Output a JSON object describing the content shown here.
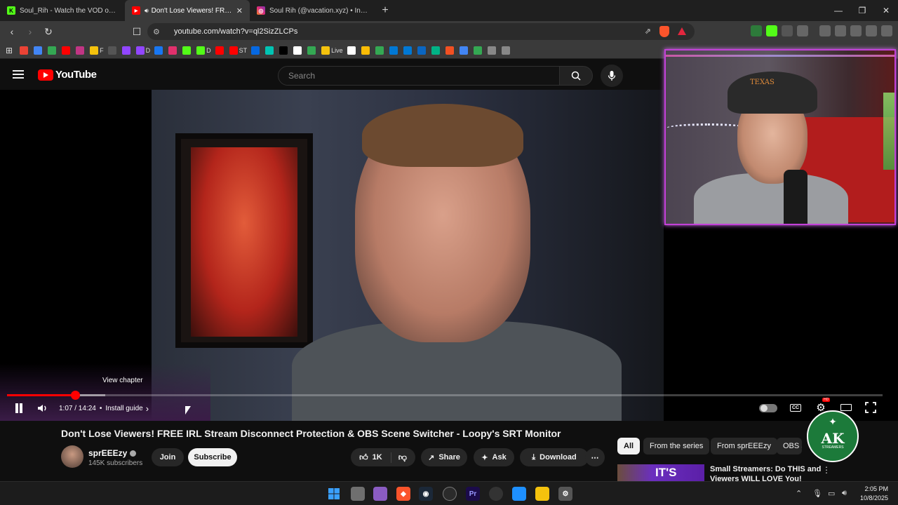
{
  "tabs": [
    {
      "title": "Soul_Rih - Watch the VOD on Kick",
      "active": false,
      "favicon_color": "#53fc18",
      "favicon_glyph": "K"
    },
    {
      "title": "Don't Lose Viewers! FREE IRL",
      "active": true,
      "favicon_color": "#ff0000",
      "favicon_glyph": "▶"
    },
    {
      "title": "Soul Rih (@vacation.xyz) • Instagram",
      "active": false,
      "favicon_color": "#d6249f",
      "favicon_glyph": "◎"
    }
  ],
  "new_tab_label": "+",
  "url": "youtube.com/watch?v=ql2SizZLCPs",
  "bookmarks": [
    {
      "label": "",
      "color": "#ea4335"
    },
    {
      "label": "",
      "color": "#4285f4"
    },
    {
      "label": "",
      "color": "#34a853"
    },
    {
      "label": "",
      "color": "#ff0000"
    },
    {
      "label": "",
      "color": "#c13584"
    },
    {
      "label": "F",
      "color": "#f4c20d"
    },
    {
      "label": "",
      "color": "#555555"
    },
    {
      "label": "",
      "color": "#9146ff"
    },
    {
      "label": "D",
      "color": "#9146ff"
    },
    {
      "label": "",
      "color": "#1877f2"
    },
    {
      "label": "",
      "color": "#e1306c"
    },
    {
      "label": "",
      "color": "#53fc18"
    },
    {
      "label": "D",
      "color": "#53fc18"
    },
    {
      "label": "",
      "color": "#ff0000"
    },
    {
      "label": "ST",
      "color": "#ff0000"
    },
    {
      "label": "",
      "color": "#0668e1"
    },
    {
      "label": "",
      "color": "#00c4b3"
    },
    {
      "label": "",
      "color": "#000000"
    },
    {
      "label": "",
      "color": "#ffffff"
    },
    {
      "label": "",
      "color": "#34a853"
    },
    {
      "label": "Live",
      "color": "#f4c20d"
    },
    {
      "label": "",
      "color": "#ffffff"
    },
    {
      "label": "",
      "color": "#fbbc05"
    },
    {
      "label": "",
      "color": "#34a853"
    },
    {
      "label": "",
      "color": "#0078d4"
    },
    {
      "label": "",
      "color": "#0078d4"
    },
    {
      "label": "",
      "color": "#0a66c2"
    },
    {
      "label": "",
      "color": "#00b386"
    },
    {
      "label": "",
      "color": "#f25022"
    },
    {
      "label": "",
      "color": "#4285f4"
    },
    {
      "label": "",
      "color": "#34a853"
    },
    {
      "label": "",
      "color": "#888888"
    },
    {
      "label": "",
      "color": "#888888"
    }
  ],
  "youtube": {
    "logo_text": "YouTube",
    "search_placeholder": "Search"
  },
  "player": {
    "chapter_tooltip": "View chapter",
    "time": "1:07 / 14:24",
    "separator": "•",
    "chapter": "Install guide",
    "chapter_chevron": "›",
    "progress_fraction": 0.078,
    "buffer_fraction": 0.112,
    "hd_badge": "HD"
  },
  "video": {
    "title": "Don't Lose Viewers! FREE IRL Stream Disconnect Protection & OBS Scene Switcher - Loopy's SRT Monitor",
    "channel": "sprEEEzy",
    "subscribers": "145K subscribers",
    "join_label": "Join",
    "subscribe_label": "Subscribe",
    "likes": "1K",
    "share_label": "Share",
    "ask_label": "Ask",
    "download_label": "Download",
    "more_label": "⋯"
  },
  "webcam": {
    "cap_text": "TEXAS"
  },
  "chips": [
    "All",
    "From the series",
    "From sprEEEzy",
    "OBS S"
  ],
  "recommendation": {
    "thumb_text": "IT'S",
    "title": "Small Streamers: Do THIS and Viewers WILL LOVE You!"
  },
  "overlay_badge": {
    "main": "AK",
    "sub": "STREAMERS"
  },
  "taskbar": {
    "time": "2:05 PM",
    "date": "10/8/2025"
  },
  "colors": {
    "accent": "#ff0000",
    "webcam_border": "#c341d8",
    "badge_green": "#1c7a3a"
  }
}
